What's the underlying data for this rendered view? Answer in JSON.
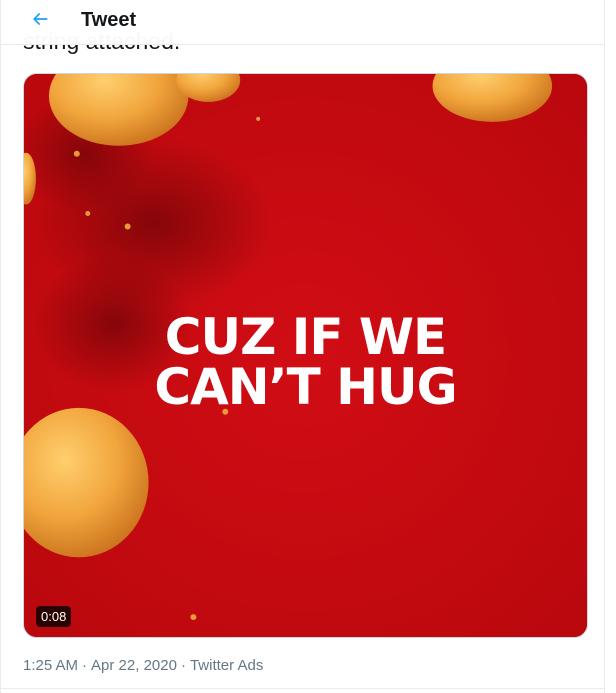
{
  "header": {
    "back_icon": "arrow-left-icon",
    "title": "Tweet"
  },
  "tweet": {
    "text_tail": "string attached."
  },
  "media": {
    "overlay_line1": "CUZ IF WE",
    "overlay_line2": "CAN’T HUG",
    "duration": "0:08",
    "background_color": "#c40a0f"
  },
  "meta": {
    "time": "1:25 AM",
    "date": "Apr 22, 2020",
    "source": "Twitter Ads",
    "separator": "·"
  },
  "colors": {
    "accent": "#1da1f2",
    "text": "#14171a",
    "secondary": "#657786",
    "border": "#e6ecf0"
  }
}
